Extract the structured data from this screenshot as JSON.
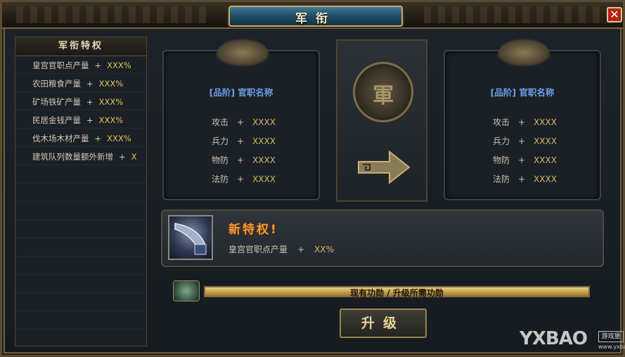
{
  "window": {
    "title": "军衔",
    "close_label": "✕"
  },
  "privileges": {
    "header": "军衔特权",
    "items": [
      {
        "label": "皇宫官职点产量",
        "plus": "+",
        "value": "XXX%"
      },
      {
        "label": "农田粮食产量",
        "plus": "+",
        "value": "XXX%"
      },
      {
        "label": "矿场铁矿产量",
        "plus": "+",
        "value": "XXX%"
      },
      {
        "label": "民居金钱产量",
        "plus": "+",
        "value": "XXX%"
      },
      {
        "label": "伐木场木材产量",
        "plus": "+",
        "value": "XXX%"
      },
      {
        "label": "建筑队列数量额外新增",
        "plus": "+",
        "value": "X"
      }
    ]
  },
  "current_rank": {
    "name": "[品阶]  官职名称",
    "stats": [
      {
        "label": "攻击",
        "plus": "+",
        "value": "XXXX"
      },
      {
        "label": "兵力",
        "plus": "+",
        "value": "XXXX"
      },
      {
        "label": "物防",
        "plus": "+",
        "value": "XXXX"
      },
      {
        "label": "法防",
        "plus": "+",
        "value": "XXXX"
      }
    ]
  },
  "next_rank": {
    "name": "[品阶]  官职名称",
    "stats": [
      {
        "label": "攻击",
        "plus": "+",
        "value": "XXXX"
      },
      {
        "label": "兵力",
        "plus": "+",
        "value": "XXXX"
      },
      {
        "label": "物防",
        "plus": "+",
        "value": "XXXX"
      },
      {
        "label": "法防",
        "plus": "+",
        "value": "XXXX"
      }
    ]
  },
  "emblem": {
    "glyph": "軍",
    "icon": "military-seal-icon"
  },
  "new_privilege": {
    "title": "新特权!",
    "label": "皇宫官职点产量",
    "plus": "+",
    "value": "XX%",
    "item_icon": "horn-item-icon"
  },
  "progress": {
    "text": "现有功勋 / 升级所需功勋",
    "fraction": 1.0,
    "icon": "bronze-vessel-icon"
  },
  "upgrade_label": "升级",
  "watermark": {
    "brand": "YXBAO",
    "badge": "游戏堡",
    "url": "www.yxbao.com"
  },
  "colors": {
    "accent": "#e7c35a",
    "rank_name": "#6e9ee8",
    "new_title": "#f29b3a",
    "close": "#b42316"
  }
}
